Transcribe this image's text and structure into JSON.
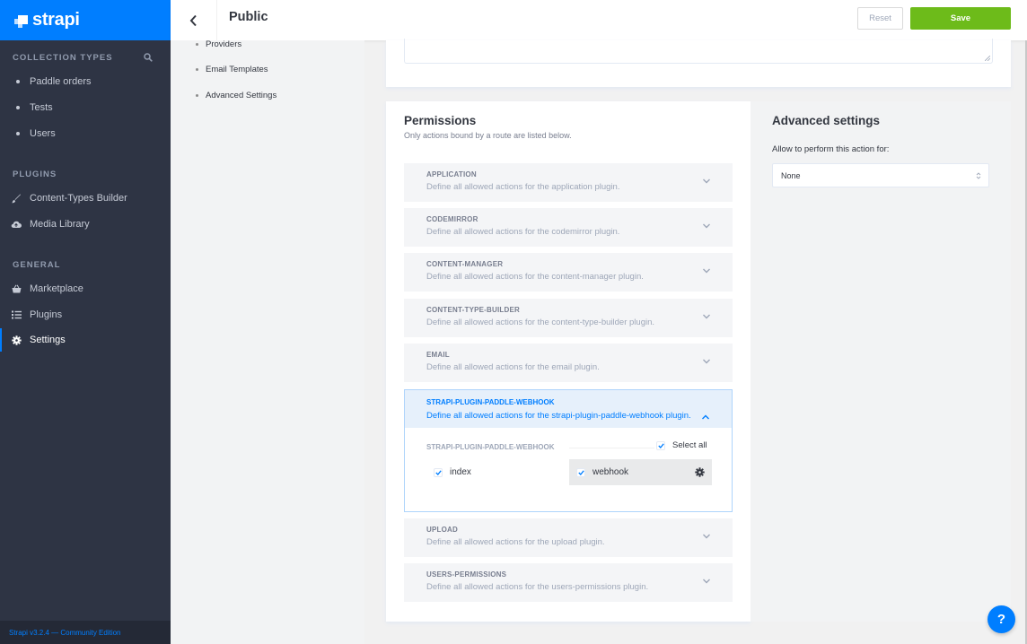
{
  "brand": {
    "name": "strapi"
  },
  "sidebar": {
    "collection_types_title": "COLLECTION TYPES",
    "collection_types": [
      "Paddle orders",
      "Tests",
      "Users"
    ],
    "plugins_title": "PLUGINS",
    "plugins": [
      {
        "label": "Content-Types Builder",
        "icon": "brush-icon"
      },
      {
        "label": "Media Library",
        "icon": "cloud-icon"
      }
    ],
    "general_title": "GENERAL",
    "general": [
      {
        "label": "Marketplace",
        "icon": "basket-icon"
      },
      {
        "label": "Plugins",
        "icon": "list-icon"
      },
      {
        "label": "Settings",
        "icon": "gear-icon",
        "active": true
      }
    ],
    "footer": "Strapi v3.2.4 — Community Edition"
  },
  "header": {
    "title": "Public",
    "reset_label": "Reset",
    "save_label": "Save"
  },
  "subnav": {
    "items": [
      "Providers",
      "Email Templates",
      "Advanced Settings"
    ]
  },
  "permissions": {
    "title": "Permissions",
    "subtitle": "Only actions bound by a route are listed below.",
    "plugins": [
      {
        "name": "APPLICATION",
        "description": "Define all allowed actions for the application plugin."
      },
      {
        "name": "CODEMIRROR",
        "description": "Define all allowed actions for the codemirror plugin."
      },
      {
        "name": "CONTENT-MANAGER",
        "description": "Define all allowed actions for the content-manager plugin."
      },
      {
        "name": "CONTENT-TYPE-BUILDER",
        "description": "Define all allowed actions for the content-type-builder plugin."
      },
      {
        "name": "EMAIL",
        "description": "Define all allowed actions for the email plugin."
      }
    ],
    "open_plugin": {
      "name": "STRAPI-PLUGIN-PADDLE-WEBHOOK",
      "description": "Define all allowed actions for the strapi-plugin-paddle-webhook plugin.",
      "controller": "STRAPI-PLUGIN-PADDLE-WEBHOOK",
      "select_all_label": "Select all",
      "actions": [
        {
          "label": "index",
          "checked": true
        },
        {
          "label": "webhook",
          "checked": true,
          "selected": true
        }
      ]
    },
    "plugins_after": [
      {
        "name": "UPLOAD",
        "description": "Define all allowed actions for the upload plugin."
      },
      {
        "name": "USERS-PERMISSIONS",
        "description": "Define all allowed actions for the users-permissions plugin."
      }
    ]
  },
  "advanced": {
    "title": "Advanced settings",
    "label": "Allow to perform this action for:",
    "select_value": "None"
  },
  "help": {
    "label": "?"
  },
  "colors": {
    "primary": "#007eff",
    "save": "#6dbb1a",
    "sidebar": "#2e3444"
  }
}
